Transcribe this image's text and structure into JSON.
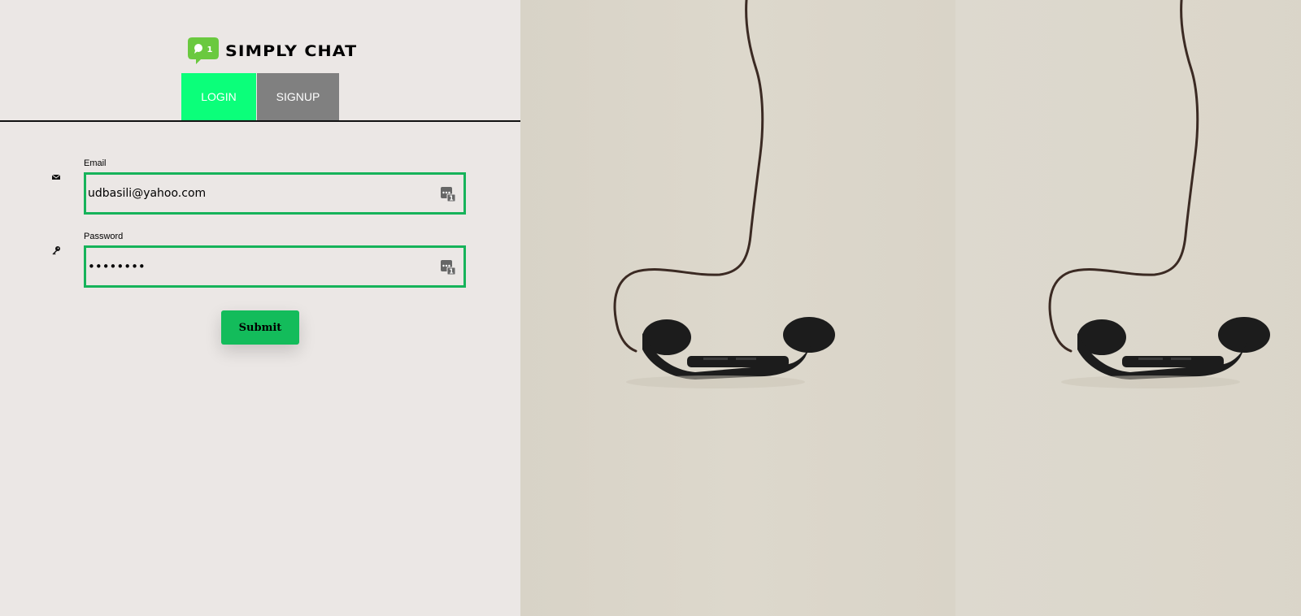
{
  "app": {
    "title": "SIMPLY CHAT",
    "logo_badge": "1",
    "logo_icon": "chat-bubble-logo",
    "brand_color": "#6ac93f"
  },
  "tabs": [
    {
      "label": "LOGIN",
      "active": true,
      "color": "#0bff7a"
    },
    {
      "label": "SIGNUP",
      "active": false,
      "color": "#808080"
    }
  ],
  "form": {
    "email": {
      "label": "Email",
      "value": "udbasili@yahoo.com",
      "icon": "envelope-icon"
    },
    "password": {
      "label": "Password",
      "value": "udbasili",
      "icon": "key-icon"
    },
    "border_color": "#16b35a",
    "autofill_icon": "password-manager-icon",
    "autofill_badge": "1",
    "submit_label": "Submit",
    "submit_color": "#13bc5b"
  },
  "hero_image": {
    "subject": "hanging-telephone-handset",
    "background_color": "#dbd6ca"
  }
}
